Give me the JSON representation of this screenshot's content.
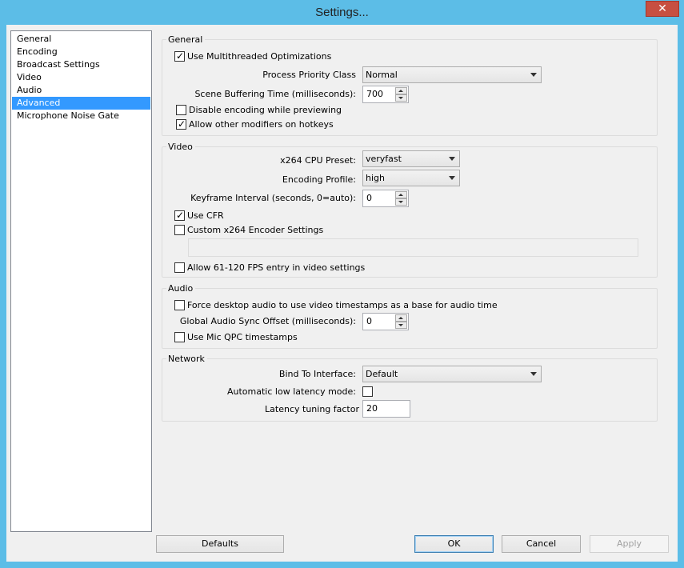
{
  "window": {
    "title": "Settings...",
    "close_glyph": "✕"
  },
  "sidebar": {
    "items": [
      {
        "label": "General"
      },
      {
        "label": "Encoding"
      },
      {
        "label": "Broadcast Settings"
      },
      {
        "label": "Video"
      },
      {
        "label": "Audio"
      },
      {
        "label": "Advanced",
        "selected": true
      },
      {
        "label": "Microphone Noise Gate"
      }
    ]
  },
  "general": {
    "title": "General",
    "multithreaded": {
      "label": "Use Multithreaded Optimizations",
      "checked": true
    },
    "priority": {
      "label": "Process Priority Class",
      "value": "Normal"
    },
    "buffering": {
      "label": "Scene Buffering Time (milliseconds):",
      "value": "700"
    },
    "disable_preview": {
      "label": "Disable encoding while previewing",
      "checked": false
    },
    "hotkeys": {
      "label": "Allow other modifiers on hotkeys",
      "checked": true
    }
  },
  "video": {
    "title": "Video",
    "preset": {
      "label": "x264 CPU Preset:",
      "value": "veryfast"
    },
    "profile": {
      "label": "Encoding Profile:",
      "value": "high"
    },
    "keyframe": {
      "label": "Keyframe Interval (seconds, 0=auto):",
      "value": "0"
    },
    "cfr": {
      "label": "Use CFR",
      "checked": true
    },
    "custom_x264": {
      "label": "Custom x264 Encoder Settings",
      "checked": false
    },
    "high_fps": {
      "label": "Allow 61-120 FPS entry in video settings",
      "checked": false
    }
  },
  "audio": {
    "title": "Audio",
    "force_desktop": {
      "label": "Force desktop audio to use video timestamps as a base for audio time",
      "checked": false
    },
    "sync_offset": {
      "label": "Global Audio Sync Offset (milliseconds):",
      "value": "0"
    },
    "mic_qpc": {
      "label": "Use Mic QPC timestamps",
      "checked": false
    }
  },
  "network": {
    "title": "Network",
    "bind": {
      "label": "Bind To Interface:",
      "value": "Default"
    },
    "low_latency": {
      "label": "Automatic low latency mode:",
      "checked": false
    },
    "tuning": {
      "label": "Latency tuning factor",
      "value": "20"
    }
  },
  "footer": {
    "defaults": "Defaults",
    "ok": "OK",
    "cancel": "Cancel",
    "apply": "Apply"
  },
  "colors": {
    "titlebar": "#5cbde7",
    "close": "#c74f41",
    "selection": "#3399ff"
  }
}
